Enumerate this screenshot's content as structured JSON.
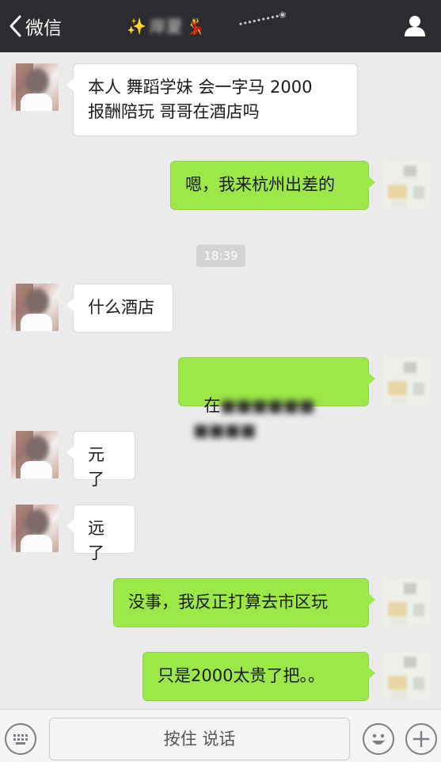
{
  "nav": {
    "back_label": "微信",
    "title_deco_left": "✨",
    "title": "岸夏",
    "title_deco_right": "💃",
    "flower_deco": "∙∙∙∙∙∙∙∙∙❀"
  },
  "timestamp": "18:39",
  "messages": [
    {
      "side": "left",
      "text": "本人 舞蹈学妹 会一字马 2000\n报酬陪玩 哥哥在酒店吗"
    },
    {
      "side": "right",
      "text": "嗯，我来杭州出差的"
    },
    {
      "side": "left",
      "text": "什么酒店"
    },
    {
      "side": "right",
      "text_visible": "在",
      "text_blurred_1": "■■■■■■",
      "text_blurred_2": "■■■■"
    },
    {
      "side": "left",
      "text": "元了"
    },
    {
      "side": "left",
      "text": "远了"
    },
    {
      "side": "right",
      "text": "没事，我反正打算去市区玩"
    },
    {
      "side": "right",
      "text": "只是2000太贵了把。。"
    }
  ],
  "bottom": {
    "keyboard_icon": "keyboard-icon",
    "voice_label": "按住 说话",
    "emoji_icon": "smile-icon",
    "plus_icon": "plus-icon"
  }
}
